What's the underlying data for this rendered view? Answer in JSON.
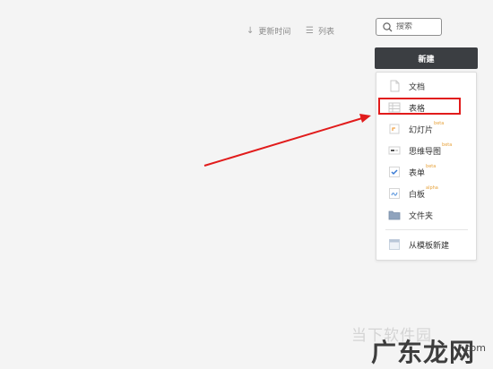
{
  "toolbar": {
    "sort_label": "更新时间",
    "view_label": "列表"
  },
  "search": {
    "placeholder": "搜索"
  },
  "new_button": {
    "label": "新建"
  },
  "menu": {
    "items": [
      {
        "label": "文档",
        "badge": "",
        "icon": "document-icon"
      },
      {
        "label": "表格",
        "badge": "",
        "icon": "spreadsheet-icon"
      },
      {
        "label": "幻灯片",
        "badge": "beta",
        "icon": "slides-icon"
      },
      {
        "label": "思维导图",
        "badge": "beta",
        "icon": "mindmap-icon"
      },
      {
        "label": "表单",
        "badge": "beta",
        "icon": "form-icon"
      },
      {
        "label": "白板",
        "badge": "alpha",
        "icon": "whiteboard-icon"
      },
      {
        "label": "文件夹",
        "badge": "",
        "icon": "folder-icon"
      },
      {
        "label": "从模板新建",
        "badge": "",
        "icon": "template-icon"
      }
    ]
  },
  "annotation": {
    "color": "#e11b1b",
    "highlighted_item": "表格"
  },
  "watermark": {
    "sub": "当下软件园",
    "main": "广东龙网",
    "suffix": ".com"
  }
}
